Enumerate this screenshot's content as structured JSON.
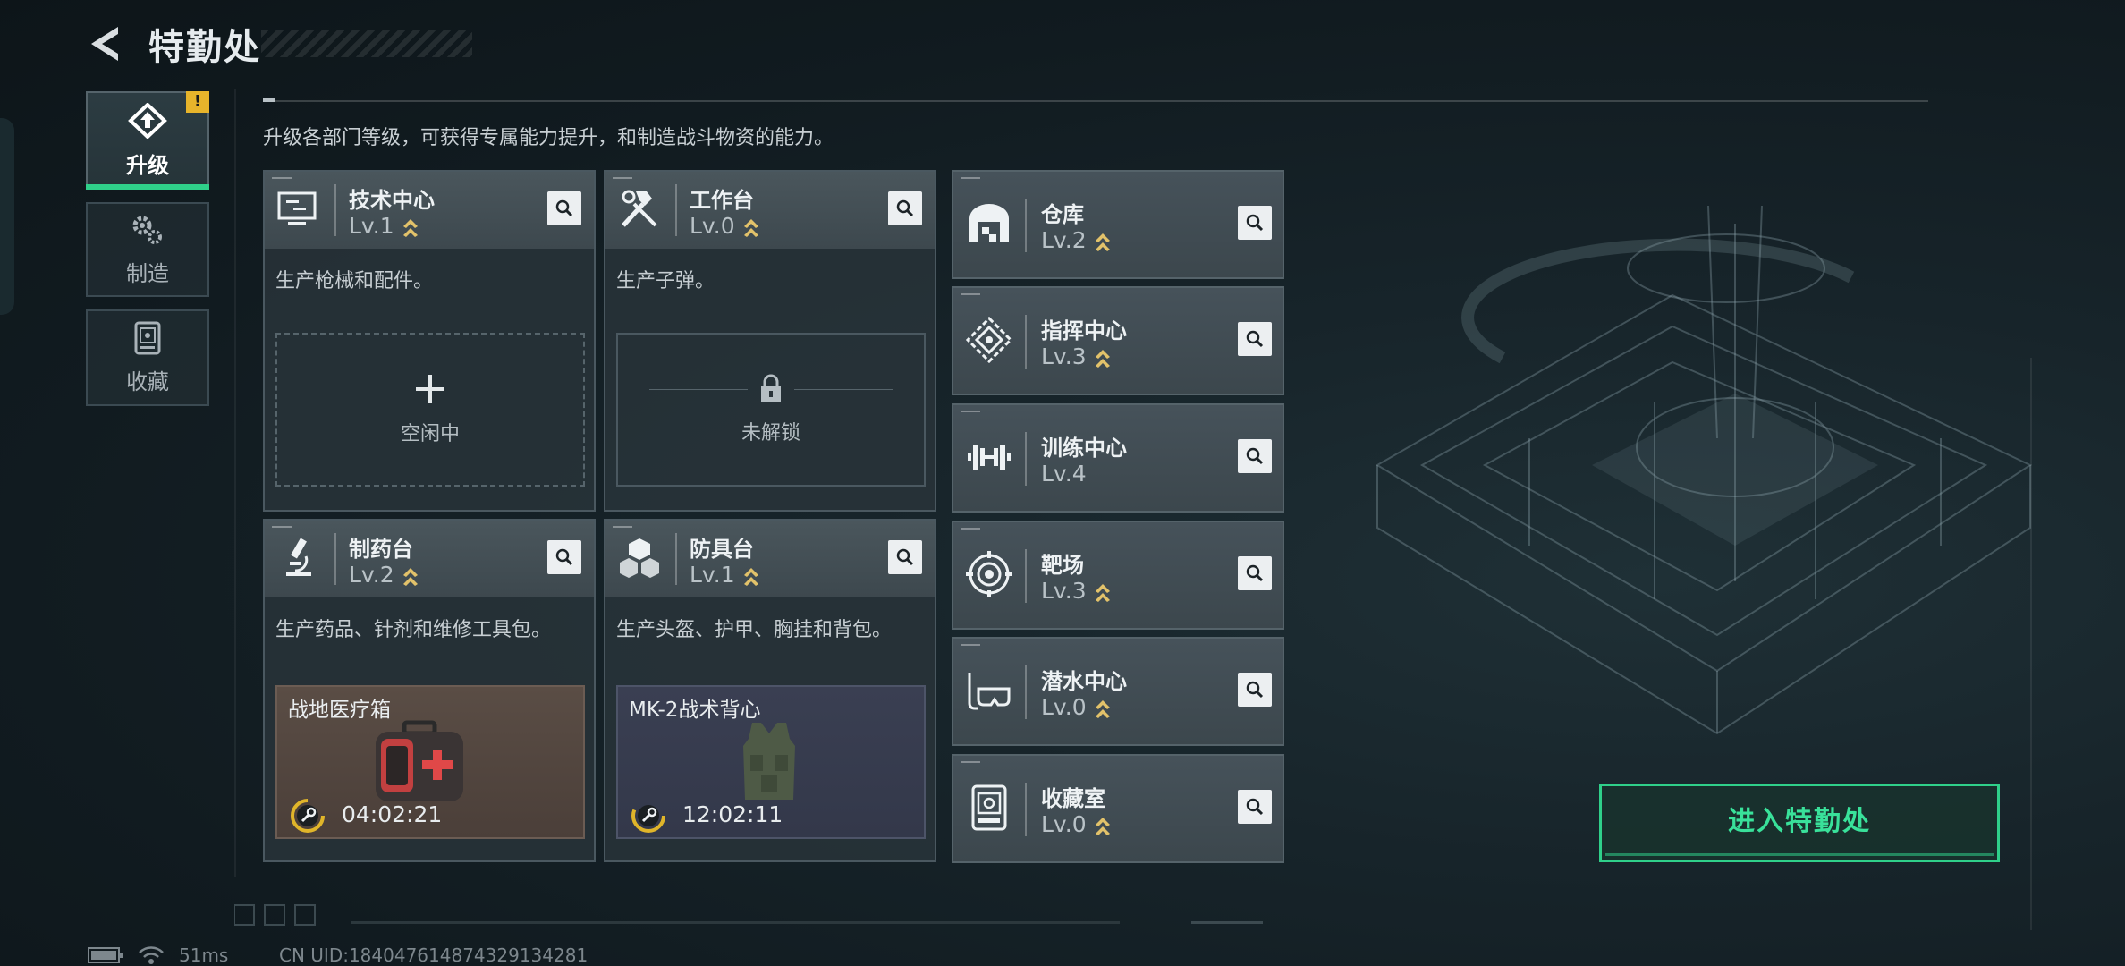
{
  "header": {
    "title": "特勤处"
  },
  "tabs": [
    {
      "label": "升级",
      "icon": "upgrade-icon",
      "active": true,
      "alert": "!"
    },
    {
      "label": "制造",
      "icon": "gears-icon",
      "active": false
    },
    {
      "label": "收藏",
      "icon": "collection-icon",
      "active": false
    }
  ],
  "description": "升级各部门等级，可获得专属能力提升，和制造战斗物资的能力。",
  "big_cards": [
    {
      "name": "技术中心",
      "level": "Lv.1",
      "upgradable": true,
      "desc": "生产枪械和配件。",
      "slot": {
        "state": "idle",
        "label": "空闲中"
      }
    },
    {
      "name": "工作台",
      "level": "Lv.0",
      "upgradable": true,
      "desc": "生产子弹。",
      "slot": {
        "state": "locked",
        "label": "未解锁"
      }
    },
    {
      "name": "制药台",
      "level": "Lv.2",
      "upgradable": true,
      "desc": "生产药品、针剂和维修工具包。",
      "slot": {
        "state": "producing",
        "item": "战地医疗箱",
        "time": "04:02:21"
      }
    },
    {
      "name": "防具台",
      "level": "Lv.1",
      "upgradable": true,
      "desc": "生产头盔、护甲、胸挂和背包。",
      "slot": {
        "state": "producing",
        "item": "MK-2战术背心",
        "time": "12:02:11"
      }
    }
  ],
  "small_cards": [
    {
      "name": "仓库",
      "level": "Lv.2",
      "upgradable": true,
      "icon": "warehouse-icon"
    },
    {
      "name": "指挥中心",
      "level": "Lv.3",
      "upgradable": true,
      "icon": "command-center-icon"
    },
    {
      "name": "训练中心",
      "level": "Lv.4",
      "upgradable": false,
      "icon": "dumbbell-icon"
    },
    {
      "name": "靶场",
      "level": "Lv.3",
      "upgradable": true,
      "icon": "target-icon"
    },
    {
      "name": "潜水中心",
      "level": "Lv.0",
      "upgradable": true,
      "icon": "diving-mask-icon"
    },
    {
      "name": "收藏室",
      "level": "Lv.0",
      "upgradable": true,
      "icon": "collection-room-icon"
    }
  ],
  "enter_button": "进入特勤处",
  "status_bar": {
    "ping": "51ms",
    "uid": "CN UID:1840476148743291342​81"
  },
  "colors": {
    "accent": "#2fd08a",
    "chevron": "#e2c26a",
    "alert": "#e7b42b"
  }
}
